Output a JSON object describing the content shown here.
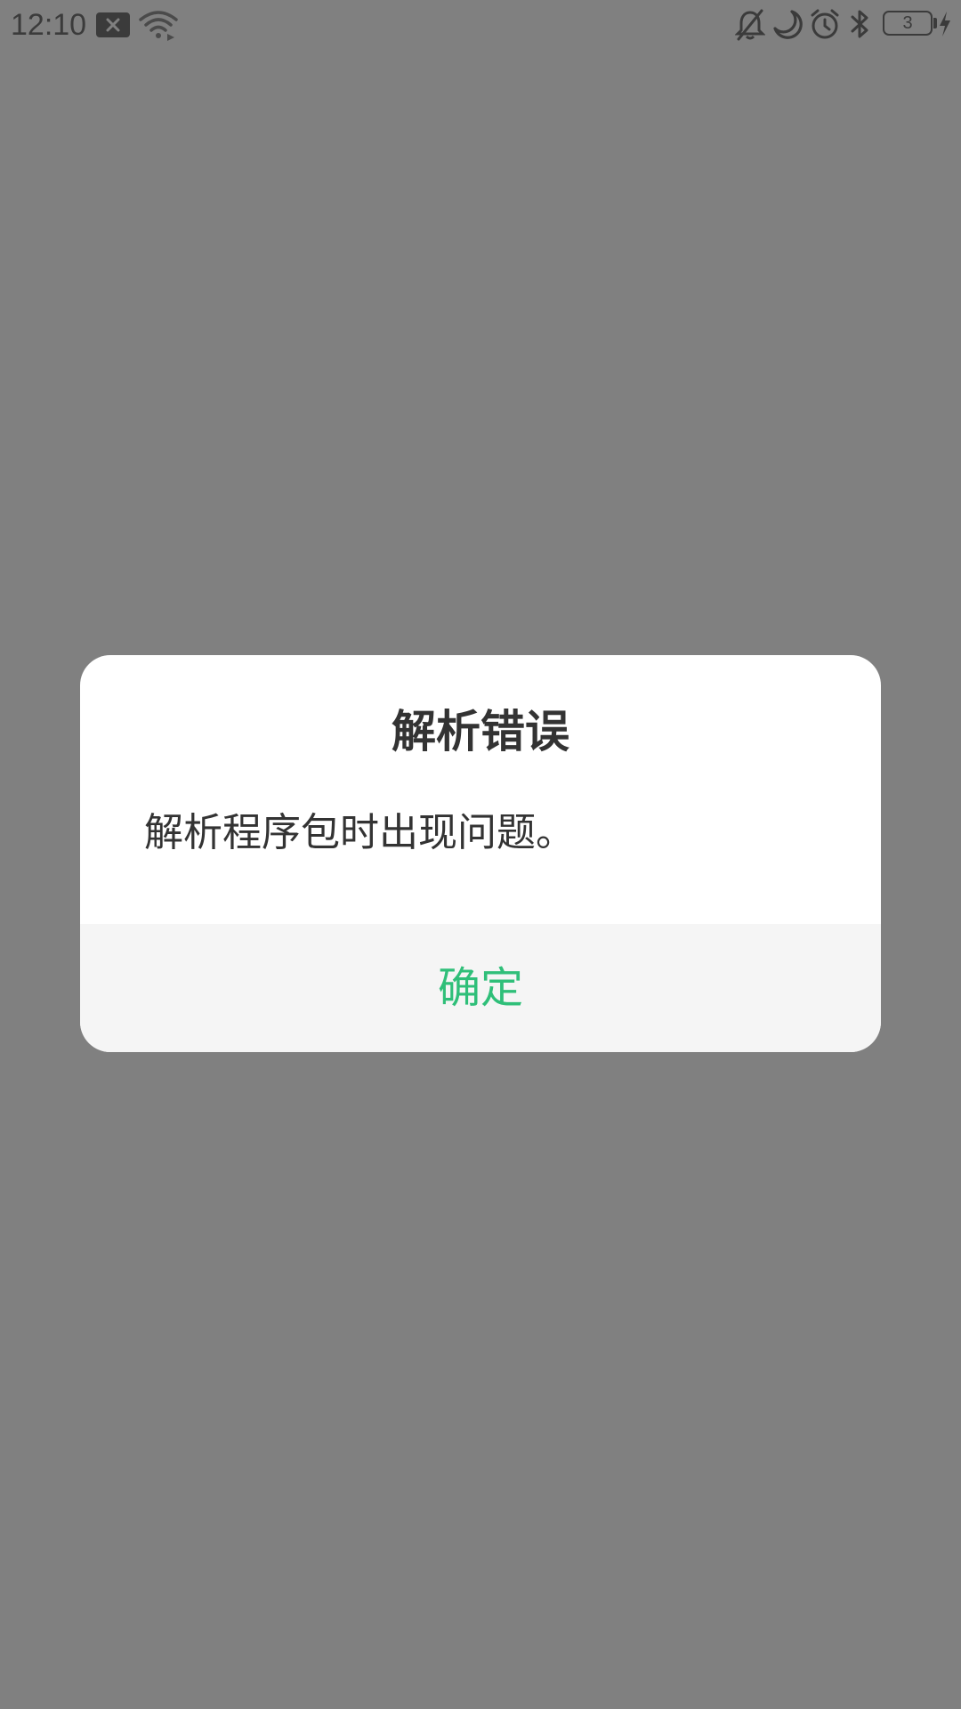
{
  "status_bar": {
    "time": "12:10",
    "battery_level": "3",
    "icons": [
      "notification-x-icon",
      "wifi-icon",
      "bell-off-icon",
      "moon-icon",
      "alarm-icon",
      "bluetooth-icon",
      "battery-icon",
      "charging-icon"
    ]
  },
  "colors": {
    "scrim": "#808080",
    "dialog_bg": "#ffffff",
    "footer_bg": "#f5f5f5",
    "accent": "#2fbf79",
    "text": "#333333"
  },
  "dialog": {
    "title": "解析错误",
    "message": "解析程序包时出现问题。",
    "ok_label": "确定"
  }
}
